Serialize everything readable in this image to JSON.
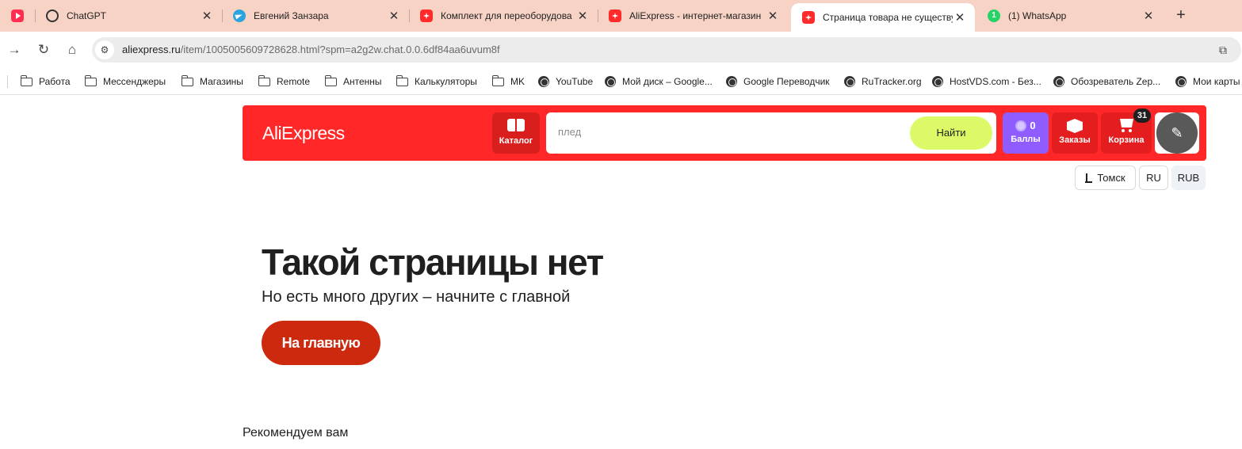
{
  "tabs": [
    {
      "label": "",
      "favicon": "youtube-icon"
    },
    {
      "label": "ChatGPT",
      "favicon": "chatgpt-icon"
    },
    {
      "label": "Евгений Занзара",
      "favicon": "telegram-icon"
    },
    {
      "label": "Комплект для переоборудова",
      "favicon": "aliexpress-icon"
    },
    {
      "label": "AliExpress - интернет-магазин",
      "favicon": "aliexpress-icon"
    },
    {
      "label": "Страница товара не существу",
      "favicon": "aliexpress-icon",
      "active": true
    },
    {
      "label": "(1) WhatsApp",
      "favicon": "whatsapp-icon",
      "badge": "1"
    }
  ],
  "address_bar": {
    "url_host": "aliexpress.ru",
    "url_path": "/item/1005005609728628.html?spm=a2g2w.chat.0.0.6df84aa6uvum8f"
  },
  "bookmarks": [
    {
      "label": "Работа",
      "icon": "folder-icon"
    },
    {
      "label": "Мессенджеры",
      "icon": "folder-icon"
    },
    {
      "label": "Магазины",
      "icon": "folder-icon"
    },
    {
      "label": "Remote",
      "icon": "folder-icon"
    },
    {
      "label": "Антенны",
      "icon": "folder-icon"
    },
    {
      "label": "Калькуляторы",
      "icon": "folder-icon"
    },
    {
      "label": "MK",
      "icon": "folder-icon"
    },
    {
      "label": "YouTube",
      "icon": "globe-icon"
    },
    {
      "label": "Мой диск – Google...",
      "icon": "globe-icon"
    },
    {
      "label": "Google Переводчик",
      "icon": "globe-icon"
    },
    {
      "label": "RuTracker.org",
      "icon": "globe-icon"
    },
    {
      "label": "HostVDS.com - Без...",
      "icon": "globe-icon"
    },
    {
      "label": "Обозреватель Zep...",
      "icon": "globe-icon"
    },
    {
      "label": "Мои карты",
      "icon": "globe-icon"
    }
  ],
  "ali_header": {
    "logo": "AliExpress",
    "catalog_label": "Каталог",
    "search_placeholder": "плед",
    "search_button": "Найти",
    "points_count": "0",
    "points_label": "Баллы",
    "orders_label": "Заказы",
    "cart_label": "Корзина",
    "cart_badge": "31"
  },
  "locale": {
    "city": "Томск",
    "language": "RU",
    "currency": "RUB"
  },
  "main": {
    "title": "Такой страницы нет",
    "subtitle": "Но есть много других – начните с главной",
    "home_button": "На главную",
    "recommend_heading": "Рекомендуем вам"
  },
  "colors": {
    "tabstrip": "#f7d3c6",
    "ali_red": "#ff2727",
    "search_button": "#dcf968",
    "points": "#8f5cff",
    "home_button": "#cc290e"
  }
}
